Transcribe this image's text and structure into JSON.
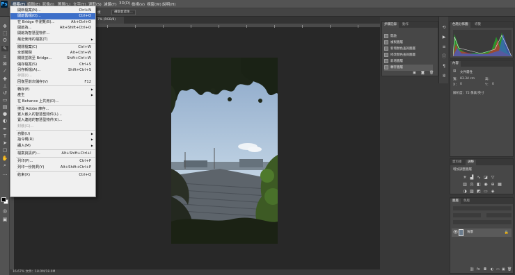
{
  "app": {
    "logo": "Ps"
  },
  "menubar": {
    "items": [
      "檔案(F)",
      "編輯(E)",
      "影像(I)",
      "圖層(L)",
      "文字(Y)",
      "選取(S)",
      "濾鏡(T)",
      "3D(D)",
      "檢視(V)",
      "視窗(W)",
      "說明(H)"
    ]
  },
  "optbar": {
    "buttons": [
      "選取並遮住..."
    ],
    "left_label": "樣"
  },
  "doctab": {
    "label": "7% (RGB/8)"
  },
  "statusbar": {
    "text": "16.67%    文件：18.0M/18.0M"
  },
  "file_menu": {
    "items": [
      {
        "label": "開新檔案(N)...",
        "shortcut": "Ctrl+N"
      },
      {
        "label": "開啟舊檔(O)...",
        "shortcut": "Ctrl+O",
        "highlight": true
      },
      {
        "label": "在 Bridge 中瀏覽(B)...",
        "shortcut": "Alt+Ctrl+O"
      },
      {
        "label": "開啟為...",
        "shortcut": "Alt+Shift+Ctrl+O"
      },
      {
        "label": "開啟為智慧型物件..."
      },
      {
        "label": "最近使用的檔案(T)",
        "submenu": true
      },
      {
        "sep": true
      },
      {
        "label": "關閉檔案(C)",
        "shortcut": "Ctrl+W"
      },
      {
        "label": "全部關閉",
        "shortcut": "Alt+Ctrl+W"
      },
      {
        "label": "關閉並跳至 Bridge...",
        "shortcut": "Shift+Ctrl+W"
      },
      {
        "label": "儲存檔案(S)",
        "shortcut": "Ctrl+S"
      },
      {
        "label": "另存新檔(A)...",
        "shortcut": "Shift+Ctrl+S"
      },
      {
        "label": "存回(I)...",
        "disabled": true
      },
      {
        "label": "回復至前次儲存(V)",
        "shortcut": "F12"
      },
      {
        "sep": true
      },
      {
        "label": "轉存(E)",
        "submenu": true
      },
      {
        "label": "產生",
        "submenu": true
      },
      {
        "label": "在 Behance 上共用(D)..."
      },
      {
        "sep": true
      },
      {
        "label": "搜尋 Adobe 庫存..."
      },
      {
        "label": "置入嵌入的智慧型物件(L)..."
      },
      {
        "label": "置入連結的智慧型物件(K)..."
      },
      {
        "label": "封裝(G)...",
        "disabled": true
      },
      {
        "sep": true
      },
      {
        "label": "自動(U)",
        "submenu": true
      },
      {
        "label": "指令碼(R)",
        "submenu": true
      },
      {
        "label": "讀入(M)",
        "submenu": true
      },
      {
        "sep": true
      },
      {
        "label": "檔案資訊(F)...",
        "shortcut": "Alt+Shift+Ctrl+I"
      },
      {
        "sep": true
      },
      {
        "label": "列印(P)...",
        "shortcut": "Ctrl+P"
      },
      {
        "label": "列印一份拷貝(Y)",
        "shortcut": "Alt+Shift+Ctrl+P"
      },
      {
        "sep": true
      },
      {
        "label": "結束(X)",
        "shortcut": "Ctrl+Q"
      }
    ]
  },
  "history_panel": {
    "tabs": [
      "步驟記錄",
      "動作"
    ],
    "items": [
      "開啟",
      "複製圖層",
      "新增顏色查詢圖層",
      "修改顏色查詢圖層",
      "新增圖層",
      "轉存圖層"
    ],
    "selected_index": 5
  },
  "histogram_panel": {
    "tabs": [
      "色階分佈圖",
      "導覽"
    ]
  },
  "properties_panel": {
    "title": "內容",
    "subtitle": "文件屬性",
    "w_label": "寬：",
    "w_value": "83.34 cm",
    "h_label": "高：",
    "h_value": "",
    "x_label": "X：",
    "x_value": "0",
    "y_label": "Y：",
    "y_value": "0",
    "resolution": "解析度：72 像素/英寸"
  },
  "adjustments_panel": {
    "tabs": [
      "資料庫",
      "調整"
    ],
    "title": "增加調整圖層"
  },
  "layers_panel": {
    "tabs": [
      "圖層",
      "色版"
    ],
    "layer_name": "背景"
  },
  "colors": {
    "menubar": "#535353",
    "highlight": "#3d6fc9",
    "panel": "#474747"
  }
}
